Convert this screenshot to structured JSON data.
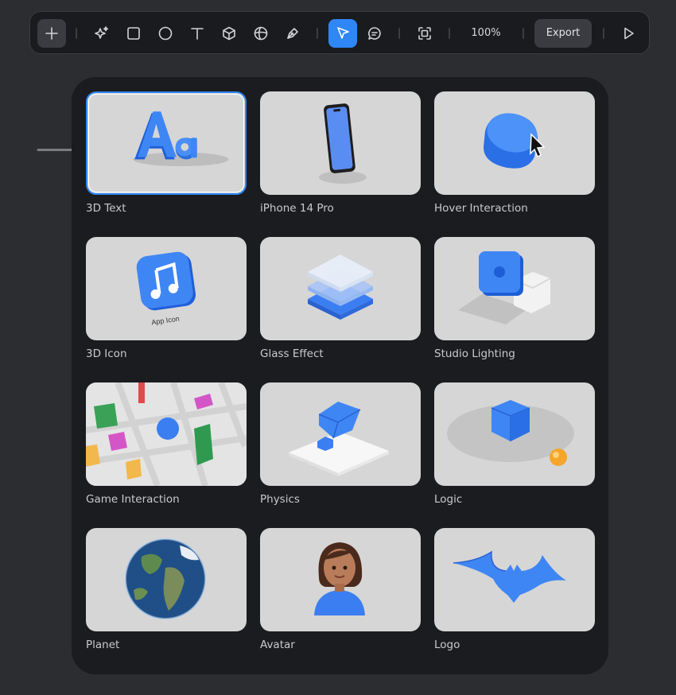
{
  "toolbar": {
    "tools": [
      {
        "id": "add",
        "icon": "plus-icon"
      },
      {
        "id": "ai",
        "icon": "sparkle-icon"
      },
      {
        "id": "rectangle",
        "icon": "rectangle-icon"
      },
      {
        "id": "ellipse",
        "icon": "circle-icon"
      },
      {
        "id": "text",
        "icon": "text-icon"
      },
      {
        "id": "cube",
        "icon": "cube-icon"
      },
      {
        "id": "sphere",
        "icon": "sphere-icon"
      },
      {
        "id": "pen",
        "icon": "pen-icon"
      },
      {
        "id": "select",
        "icon": "cursor-icon",
        "active": true
      },
      {
        "id": "comment",
        "icon": "comment-icon"
      },
      {
        "id": "frame",
        "icon": "frame-icon"
      },
      {
        "id": "play",
        "icon": "play-icon"
      }
    ],
    "zoom": "100%",
    "export_label": "Export"
  },
  "library": {
    "items": [
      {
        "label": "3D Text",
        "selected": true
      },
      {
        "label": "iPhone 14 Pro"
      },
      {
        "label": "Hover Interaction"
      },
      {
        "label": "3D Icon",
        "thumb_text": "App Icon"
      },
      {
        "label": "Glass Effect"
      },
      {
        "label": "Studio Lighting"
      },
      {
        "label": "Game Interaction"
      },
      {
        "label": "Physics"
      },
      {
        "label": "Logic"
      },
      {
        "label": "Planet"
      },
      {
        "label": "Avatar"
      },
      {
        "label": "Logo"
      }
    ]
  },
  "theme": {
    "accent": "#2f86f7",
    "background": "#2b2d31",
    "panel": "#1b1c1f",
    "card": "#d6d6d6"
  }
}
